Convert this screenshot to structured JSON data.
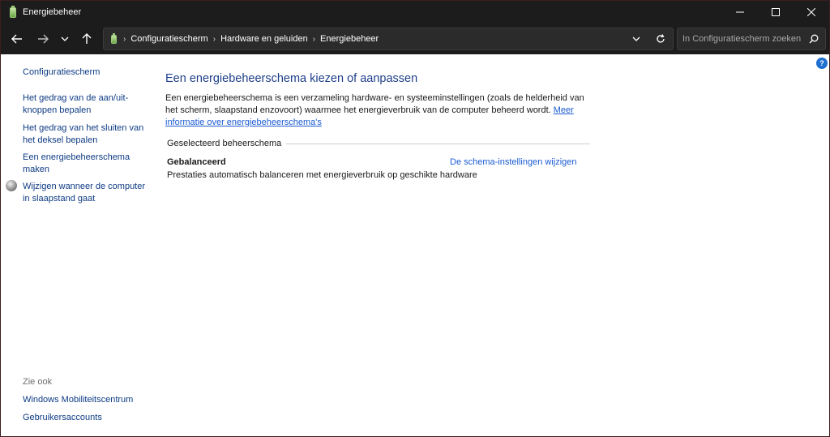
{
  "window": {
    "title": "Energiebeheer"
  },
  "address": {
    "breadcrumbs": [
      "Configuratiescherm",
      "Hardware en geluiden",
      "Energiebeheer"
    ]
  },
  "search": {
    "placeholder": "In Configuratiescherm zoeken"
  },
  "sidebar": {
    "home": "Configuratiescherm",
    "links": [
      "Het gedrag van de aan/uit-knoppen bepalen",
      "Het gedrag van het sluiten van het deksel bepalen",
      "Een energiebeheerschema maken",
      "Wijzigen wanneer de computer in slaapstand gaat"
    ],
    "see_also_title": "Zie ook",
    "see_also": [
      "Windows Mobiliteitscentrum",
      "Gebruikersaccounts"
    ]
  },
  "main": {
    "title": "Een energiebeheerschema kiezen of aanpassen",
    "description": "Een energiebeheerschema is een verzameling hardware- en systeeminstellingen (zoals de helderheid van het scherm, slaapstand enzovoort) waarmee het energieverbruik van de computer beheerd wordt. ",
    "more_info_link": "Meer informatie over energiebeheerschema's",
    "section_header": "Geselecteerd beheerschema",
    "plan": {
      "name": "Gebalanceerd",
      "change_link": "De schema-instellingen wijzigen",
      "description": "Prestaties automatisch balanceren met energieverbruik op geschikte hardware"
    }
  },
  "icons": {
    "app": "battery-icon",
    "back": "arrow-left-icon",
    "forward": "arrow-right-icon",
    "recent": "chevron-down-icon",
    "up": "arrow-up-icon",
    "refresh": "refresh-icon",
    "search": "search-icon",
    "help": "help-icon"
  },
  "colors": {
    "link": "#0e3b84",
    "accent_link": "#1a5bd1",
    "title": "#1e3f8a",
    "chrome": "#1c1c1c"
  }
}
